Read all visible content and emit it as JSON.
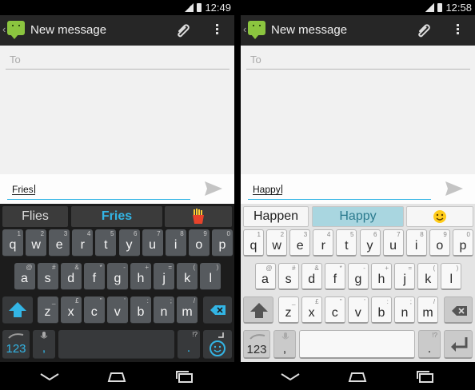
{
  "left": {
    "status": {
      "time": "12:49"
    },
    "title": "New message",
    "to_placeholder": "To",
    "compose_text": "Fries",
    "suggestions": [
      "Flies",
      "Fries"
    ],
    "suggestion_emoji": "french-fries-icon",
    "hints": {
      "row1": [
        "1",
        "2",
        "3",
        "4",
        "5",
        "6",
        "7",
        "8",
        "9",
        "0"
      ],
      "row2": [
        "@",
        "#",
        "&",
        "*",
        "-",
        "+",
        "=",
        "(",
        ")"
      ],
      "row3": [
        "_",
        "£",
        "\"",
        "'",
        ":",
        ";",
        "/"
      ],
      "comma": "",
      "period": "!?"
    }
  },
  "right": {
    "status": {
      "time": "12:58"
    },
    "title": "New message",
    "to_placeholder": "To",
    "compose_text": "Happy",
    "suggestions": [
      "Happen",
      "Happy"
    ],
    "suggestion_emoji": "smiley-face-icon",
    "hints": {
      "row1": [
        "1",
        "2",
        "3",
        "4",
        "5",
        "6",
        "7",
        "8",
        "9",
        "0"
      ],
      "row2": [
        "@",
        "#",
        "&",
        "*",
        "-",
        "+",
        "=",
        "(",
        ")"
      ],
      "row3": [
        "_",
        "£",
        "\"",
        "'",
        ":",
        ";",
        "/"
      ],
      "comma": "",
      "period": "!?"
    }
  },
  "keyboard": {
    "row1": [
      "q",
      "w",
      "e",
      "r",
      "t",
      "y",
      "u",
      "i",
      "o",
      "p"
    ],
    "row2": [
      "a",
      "s",
      "d",
      "f",
      "g",
      "h",
      "j",
      "k",
      "l"
    ],
    "row3": [
      "z",
      "x",
      "c",
      "v",
      "b",
      "n",
      "m"
    ],
    "symbols_key": "123",
    "comma": ",",
    "period": "."
  },
  "colors": {
    "accent": "#33b5e5",
    "app_icon": "#8bc53f",
    "dark_key": "#565a5e",
    "light_key": "#f8f8f8"
  }
}
